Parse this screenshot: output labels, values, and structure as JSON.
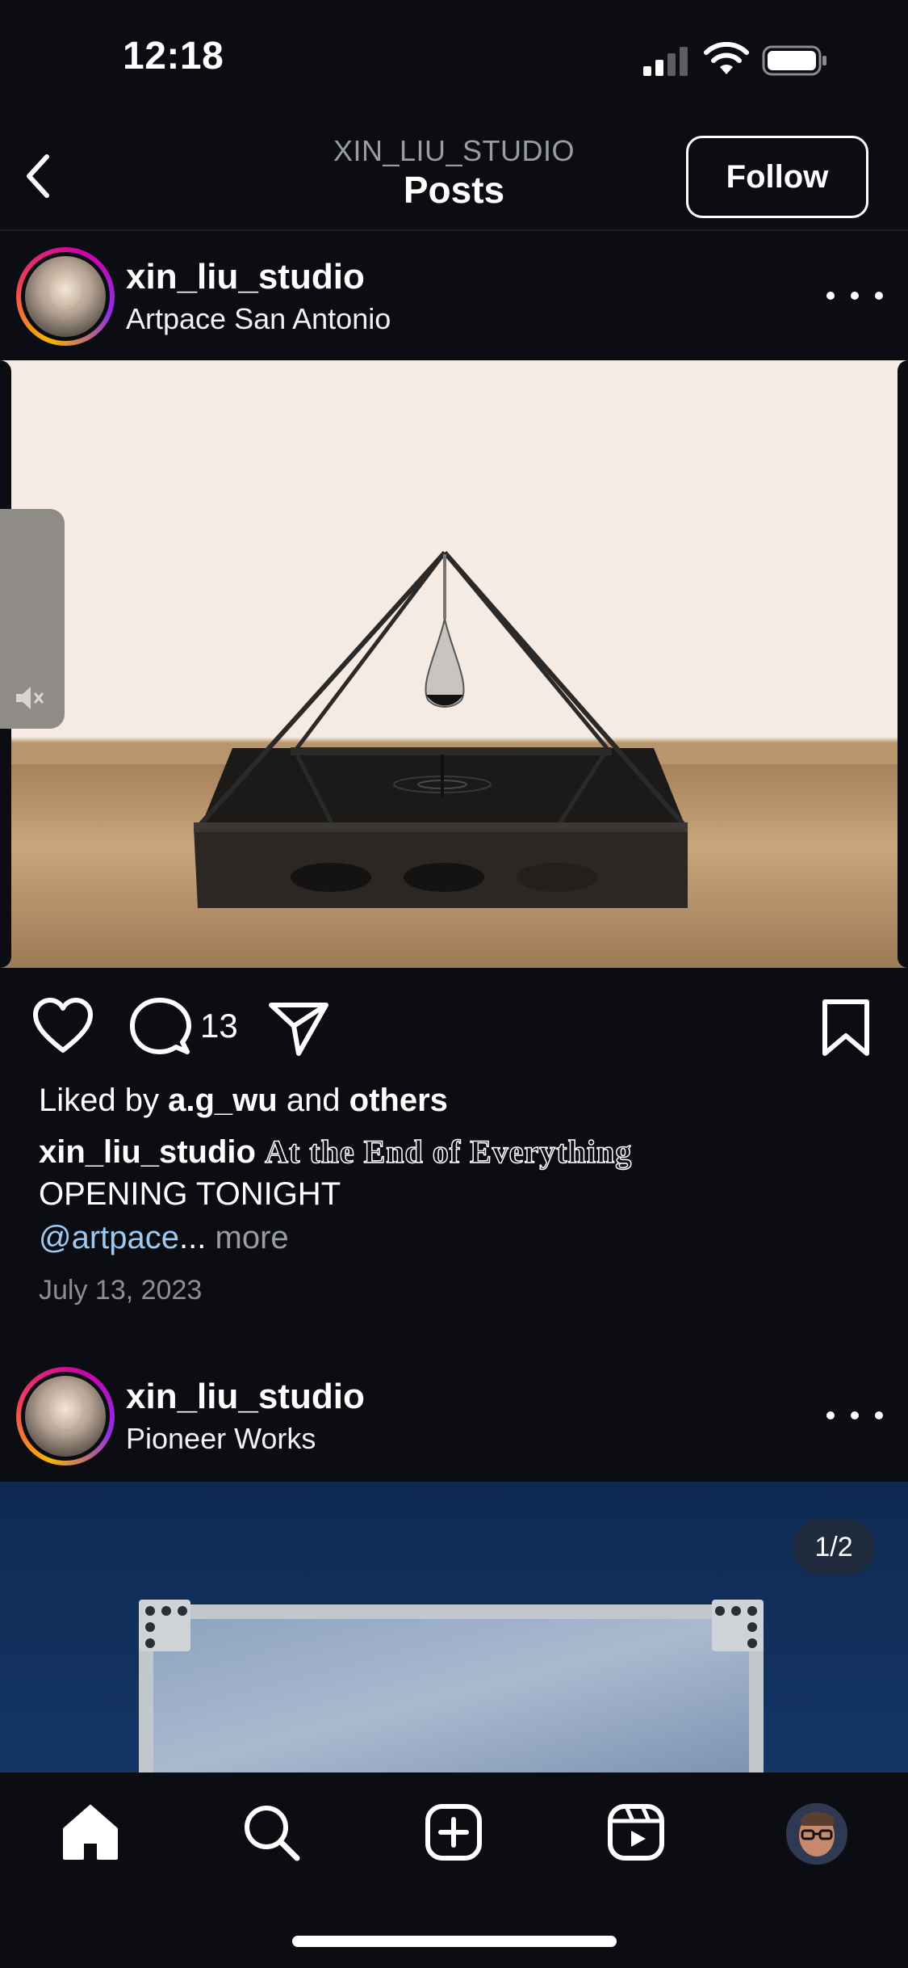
{
  "status_bar": {
    "time": "12:18"
  },
  "header": {
    "subtitle": "XIN_LIU_STUDIO",
    "title": "Posts",
    "follow_label": "Follow"
  },
  "posts": [
    {
      "username": "xin_liu_studio",
      "location": "Artpace San Antonio",
      "comment_count": "13",
      "likes": {
        "prefix": "Liked by ",
        "user": "a.g_wu",
        "middle": " and ",
        "others": "others"
      },
      "caption": {
        "username": "xin_liu_studio",
        "title": "At the End of Everything",
        "line2": "OPENING TONIGHT",
        "mention": "@artpace",
        "ellipsis": "...",
        "more": "more"
      },
      "date": "July 13, 2023"
    },
    {
      "username": "xin_liu_studio",
      "location": "Pioneer Works",
      "carousel_counter": "1/2"
    }
  ],
  "icons": {
    "back": "chevron-left-icon",
    "more": "more-horizontal-icon",
    "like": "heart-icon",
    "comment": "comment-icon",
    "share": "send-icon",
    "save": "bookmark-icon",
    "mute": "speaker-muted-icon",
    "home": "home-icon",
    "search": "search-icon",
    "create": "plus-square-icon",
    "reels": "reels-icon",
    "profile": "profile-avatar"
  },
  "colors": {
    "background": "#0b0d12",
    "mention": "#9fc9f0",
    "muted_text": "#8c8e94"
  }
}
